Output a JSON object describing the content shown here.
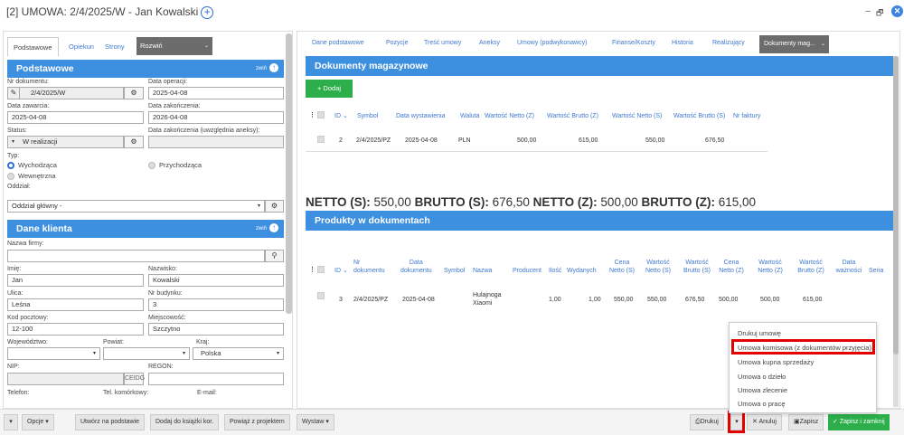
{
  "window": {
    "title": "[2] UMOWA: 2/4/2025/W - Jan Kowalski",
    "add_icon": "+",
    "minimize": "−",
    "restore": "🗗",
    "close": "✕"
  },
  "left": {
    "tabs": [
      "Podstawowe",
      "Opiekun",
      "Strony"
    ],
    "expand": "Rozwiń",
    "sec1": {
      "title": "Podstawowe",
      "right": "zwiń"
    },
    "nr_label": "Nr dokumentu:",
    "nr_value": "2/4/2025/W",
    "data_op_label": "Data operacji:",
    "data_op_value": "2025-04-08",
    "data_zaw_label": "Data zawarcia:",
    "data_zaw_value": "2025-04-08",
    "data_zak_label": "Data zakończenia:",
    "data_zak_value": "2026-04-08",
    "status_label": "Status:",
    "status_value": "W realizacji",
    "data_zak2_label": "Data zakończenia (uwzględnia aneksy):",
    "typ_label": "Typ:",
    "typ1": "Wychodząca",
    "typ2": "Przychodząca",
    "typ3": "Wewnętrzna",
    "oddzial_label": "Oddział:",
    "oddzial_value": "Oddział główny -",
    "sec2": {
      "title": "Dane klienta",
      "right": "zwiń"
    },
    "firma_label": "Nazwa firmy:",
    "imie_label": "Imię:",
    "imie_value": "Jan",
    "nazwisko_label": "Nazwisko:",
    "nazwisko_value": "Kowalski",
    "ulica_label": "Ulica:",
    "ulica_value": "Leśna",
    "nr_bud_label": "Nr budynku:",
    "nr_bud_value": "3",
    "kod_label": "Kod pocztowy:",
    "kod_value": "12-100",
    "miejsc_label": "Miejscowość:",
    "miejsc_value": "Szczytno",
    "woj_label": "Województwo:",
    "powiat_label": "Powiat:",
    "kraj_label": "Kraj:",
    "kraj_value": "Polska",
    "nip_label": "NIP:",
    "ceidg": "CEIDG",
    "regon_label": "REGON:",
    "tel_label": "Telefon:",
    "telkom_label": "Tel. komórkowy:",
    "email_label": "E-mail:"
  },
  "right": {
    "tabs": [
      "Dane podstawowe",
      "Pozycje",
      "Treść umowy",
      "Aneksy",
      "Umowy (podwykonawcy)",
      "Finanse/Koszty",
      "Historia",
      "Realizujący"
    ],
    "active_tab": "Dokumenty mag...",
    "sec1": "Dokumenty magazynowe",
    "dodaj": "+ Dodaj",
    "t1_headers": [
      "ID",
      "Symbol",
      "Data wystawienia",
      "Waluta",
      "Wartość Netto (Z)",
      "Wartość Brutto (Z)",
      "Wartość Netto (S)",
      "Wartość Brutto (S)",
      "Nr faktury"
    ],
    "t1_row": [
      "2",
      "2/4/2025/PZ",
      "2025-04-08",
      "PLN",
      "500,00",
      "615,00",
      "550,00",
      "676,50"
    ],
    "totals": {
      "l1": "NETTO (S):",
      "v1": "550,00",
      "l2": "BRUTTO (S):",
      "v2": "676,50",
      "l3": "NETTO (Z):",
      "v3": "500,00",
      "l4": "BRUTTO (Z):",
      "v4": "615,00"
    },
    "sec2": "Produkty w dokumentach",
    "t2_headers": {
      "id": "ID",
      "nr1": "Nr",
      "nr2": "dokumentu",
      "data1": "Data",
      "data2": "dokumentu",
      "symbol": "Symbol",
      "nazwa": "Nazwa",
      "producent": "Producent",
      "ilosc": "Ilość",
      "wydanych": "Wydanych",
      "cena1": "Cena",
      "cena2": "Netto (S)",
      "wn1": "Wartość",
      "wn2": "Netto (S)",
      "wb1": "Wartość",
      "wb2": "Brutto (S)",
      "cz1": "Cena",
      "cz2": "Netto (Z)",
      "wnz1": "Wartość",
      "wnz2": "Netto (Z)",
      "wbz1": "Wartość",
      "wbz2": "Brutto (Z)",
      "dw1": "Data",
      "dw2": "ważności",
      "seria": "Seria"
    },
    "t2_row": {
      "id": "3",
      "nr": "2/4/2025/PZ",
      "data": "2025-04-08",
      "nazwa1": "Hulajnoga",
      "nazwa2": "Xiaomi",
      "ilosc": "1,00",
      "wydanych": "1,00",
      "cena": "550,00",
      "wn": "550,00",
      "wb": "676,50",
      "cz": "500,00",
      "wnz": "500,00",
      "wbz": "615,00"
    }
  },
  "menu": [
    "Drukuj umowę",
    "Umowa komisowa (z dokumentów przyjęcia)",
    "Umowa kupna sprzedaży",
    "Umowa o dzieło",
    "Umowa zlecenie",
    "Umowa o pracę"
  ],
  "footer": {
    "opcje": "Opcje",
    "utworz": "Utwórz na podstawie",
    "dodaj_ks": "Dodaj do książki kor.",
    "powiaz": "Powiąż z projektem",
    "wystaw": "Wystaw",
    "drukuj": "Drukuj",
    "anuluj": "Anuluj",
    "zapisz": "Zapisz",
    "zapisz_zamknij": "Zapisz i zamknij"
  }
}
